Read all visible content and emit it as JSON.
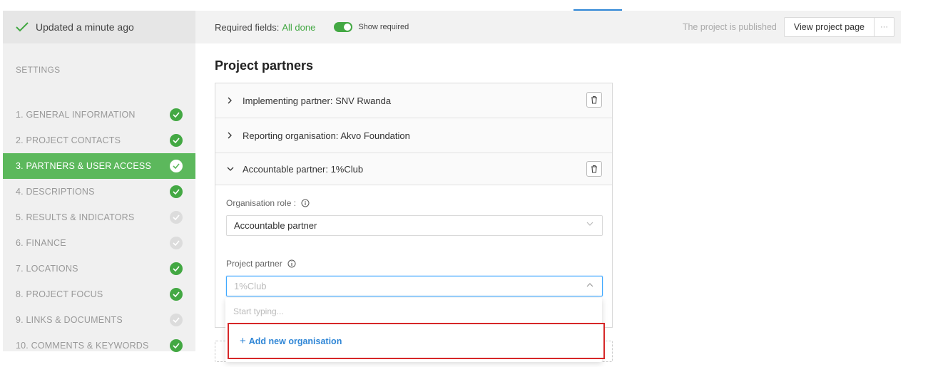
{
  "status": {
    "updated": "Updated a minute ago"
  },
  "sidebar": {
    "section": "SETTINGS",
    "items": [
      {
        "label": "1. GENERAL INFORMATION",
        "state": "complete"
      },
      {
        "label": "2. PROJECT CONTACTS",
        "state": "complete"
      },
      {
        "label": "3. PARTNERS & USER ACCESS",
        "state": "active"
      },
      {
        "label": "4. DESCRIPTIONS",
        "state": "complete"
      },
      {
        "label": "5. RESULTS & INDICATORS",
        "state": "incomplete"
      },
      {
        "label": "6. FINANCE",
        "state": "incomplete"
      },
      {
        "label": "7. LOCATIONS",
        "state": "complete"
      },
      {
        "label": "8. PROJECT FOCUS",
        "state": "complete"
      },
      {
        "label": "9. LINKS & DOCUMENTS",
        "state": "incomplete"
      },
      {
        "label": "10. COMMENTS & KEYWORDS",
        "state": "complete"
      }
    ]
  },
  "header": {
    "required_label": "Required fields:",
    "required_value": "All done",
    "show_required": "Show required",
    "published": "The project is published",
    "view_button": "View project page",
    "more_button": "···"
  },
  "main": {
    "title": "Project partners",
    "partners": [
      {
        "label": "Implementing partner: SNV Rwanda",
        "expanded": false
      },
      {
        "label": "Reporting organisation: Akvo Foundation",
        "expanded": false
      },
      {
        "label": "Accountable partner: 1%Club",
        "expanded": true
      }
    ],
    "role_label": "Organisation role :",
    "role_value": "Accountable partner",
    "partner_label": "Project partner",
    "partner_value": "1%Club",
    "search_placeholder": "Start typing...",
    "add_new": "Add new organisation"
  },
  "colors": {
    "accent": "#2f86d6",
    "success": "#43a843",
    "active_bg": "#5cb85c",
    "highlight": "#d62728"
  }
}
